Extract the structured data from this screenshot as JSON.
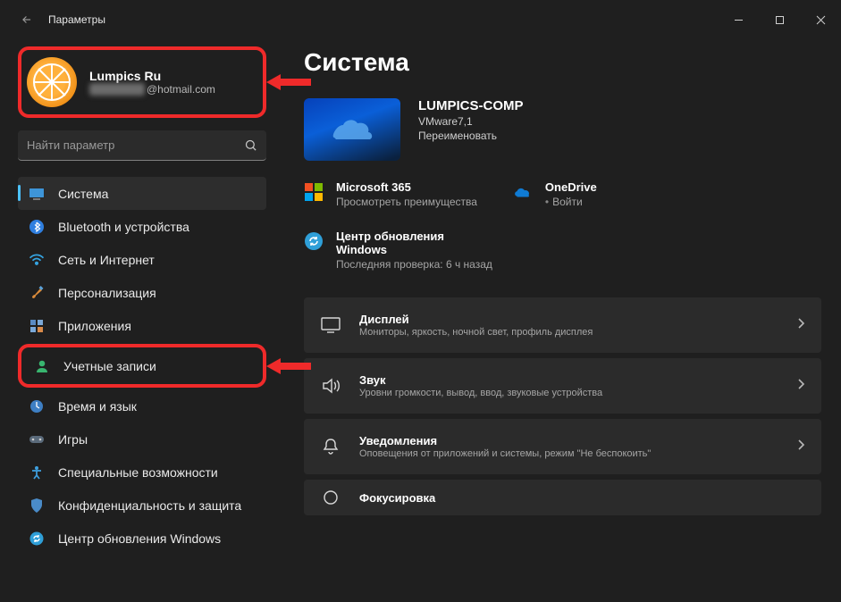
{
  "window": {
    "title": "Параметры"
  },
  "account": {
    "name": "Lumpics Ru",
    "email_hidden_suffix": "@hotmail.com"
  },
  "search": {
    "placeholder": "Найти параметр"
  },
  "sidebar": {
    "items": [
      {
        "label": "Система"
      },
      {
        "label": "Bluetooth и устройства"
      },
      {
        "label": "Сеть и Интернет"
      },
      {
        "label": "Персонализация"
      },
      {
        "label": "Приложения"
      },
      {
        "label": "Учетные записи"
      },
      {
        "label": "Время и язык"
      },
      {
        "label": "Игры"
      },
      {
        "label": "Специальные возможности"
      },
      {
        "label": "Конфиденциальность и защита"
      },
      {
        "label": "Центр обновления Windows"
      }
    ]
  },
  "main": {
    "title": "Система",
    "device": {
      "name": "LUMPICS-COMP",
      "model": "VMware7,1",
      "rename": "Переименовать"
    },
    "tiles": {
      "m365": {
        "title": "Microsoft 365",
        "sub": "Просмотреть преимущества"
      },
      "onedrive": {
        "title": "OneDrive",
        "sub": "Войти"
      },
      "update": {
        "title": "Центр обновления Windows",
        "sub": "Последняя проверка: 6 ч назад"
      }
    },
    "cards": [
      {
        "title": "Дисплей",
        "sub": "Мониторы, яркость, ночной свет, профиль дисплея"
      },
      {
        "title": "Звук",
        "sub": "Уровни громкости, вывод, ввод, звуковые устройства"
      },
      {
        "title": "Уведомления",
        "sub": "Оповещения от приложений и системы, режим \"Не беспокоить\""
      },
      {
        "title": "Фокусировка",
        "sub": ""
      }
    ]
  }
}
